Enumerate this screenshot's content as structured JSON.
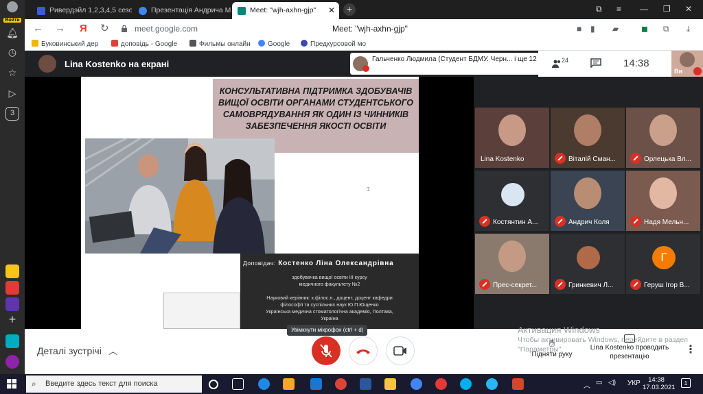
{
  "sidepanel": {
    "login_label": "Войти"
  },
  "tabs": [
    {
      "label": "Ривердэйл 1,2,3,4,5 сезон",
      "color": "#3b5bdb"
    },
    {
      "label": "Презентація Андрича Ми",
      "color": "#4285f4"
    },
    {
      "label": "Meet: \"wjh-axhn-gjp\"",
      "color": "#00897b"
    }
  ],
  "address": {
    "url": "meet.google.com",
    "title": "Meet: \"wjh-axhn-gjp\"",
    "yandex_glyph": "Я"
  },
  "bookmarks": [
    {
      "label": "Буковинський дер",
      "color": "#f4b400"
    },
    {
      "label": "доповідь - Google",
      "color": "#db4437"
    },
    {
      "label": "Фильмы онлайн",
      "color": "#555"
    },
    {
      "label": "Google",
      "color": "#4285f4"
    },
    {
      "label": "Предкурсовой мо",
      "color": "#3949ab"
    }
  ],
  "meet": {
    "presenter_label": "Lina Kostenko на екрані",
    "speaking": "Гальченко Людмила (Студент БДМУ. Черн... і ще 12",
    "people_count": "24",
    "time": "14:38",
    "self_label": "Ви"
  },
  "slide": {
    "title": "КОНСУЛЬТАТИВНА ПІДТРИМКА ЗДОБУВАЧІВ ВИЩОЇ ОСВІТИ ОРГАНАМИ СТУДЕНТСЬКОГО САМОВРЯДУВАННЯ ЯК ОДИН ІЗ ЧИННИКІВ ЗАБЕЗПЕЧЕННЯ ЯКОСТІ ОСВІТИ",
    "speaker_role": "Доповідач:",
    "speaker_name": "Костенко Ліна Олександрівна",
    "speaker_detail_1": "здобувачка вищої освіти III курсу",
    "speaker_detail_2": "медичного факультету №2",
    "supervisor_1": "Науковий керівник: к.філос.н., доцент, доцент кафедри",
    "supervisor_2": "філософії та суспільних наук Ю.П.Ющенко",
    "supervisor_3": "Українська медична стоматологічна академія, Полтава,",
    "supervisor_4": "Україна"
  },
  "participants": [
    {
      "name": "Lina Kostenko",
      "muted": false,
      "bg": "#5a3f3a",
      "face": "#c89a86"
    },
    {
      "name": "Віталій Сман...",
      "muted": true,
      "bg": "#4a3a30",
      "face": "#b07e66"
    },
    {
      "name": "Орлецька Вл...",
      "muted": true,
      "bg": "#6b5148",
      "face": "#caa08a"
    },
    {
      "name": "Костянтин А...",
      "muted": true,
      "bg": "#2d2f33",
      "avatar_color": "#d9e6f2",
      "avatar": ""
    },
    {
      "name": "Андрич Коля",
      "muted": true,
      "bg": "#3a4452",
      "face": "#b88d74"
    },
    {
      "name": "Надя Мельн...",
      "muted": true,
      "bg": "#7b5a50",
      "face": "#e2b8a2"
    },
    {
      "name": "Прес-секрет...",
      "muted": true,
      "bg": "#8a7a6e",
      "face": "#c49a84"
    },
    {
      "name": "Гринкевич Л...",
      "muted": true,
      "bg": "#2d2f33",
      "avatar_color": "#b06a4a",
      "avatar": ""
    },
    {
      "name": "Геруш Ігор В...",
      "muted": true,
      "bg": "#2d2f33",
      "avatar_color": "#f57c00",
      "avatar": "Г"
    }
  ],
  "bottombar": {
    "details": "Деталі зустрічі",
    "tooltip": "Увімкнути мікрофон (ctrl + d)",
    "watermark_title": "Активация Windows",
    "watermark_sub": "Чтобы активировать Windows, перейдите в раздел \"Параметры\".",
    "raise_hand": "Підняти руку",
    "present": "Lina Kostenko проводить презентацію"
  },
  "taskbar": {
    "search": "Введите здесь текст для поиска",
    "lang": "УКР",
    "time": "14:38",
    "date": "17.03.2021",
    "notifications": "1"
  },
  "colors": {
    "accent_red": "#d93025",
    "meet_bg": "#202124",
    "tile_bg": "#3c4043"
  }
}
